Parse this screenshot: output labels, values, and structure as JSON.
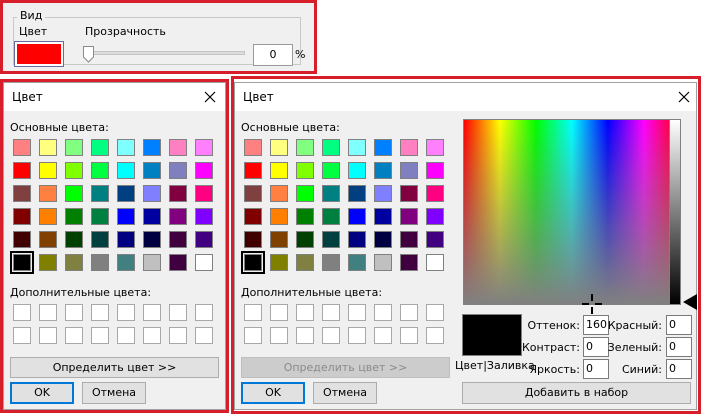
{
  "view_panel": {
    "legend": "Вид",
    "color_label": "Цвет",
    "color_value": "#ff0000",
    "opacity_label": "Прозрачность",
    "opacity_value": "0",
    "percent": "%"
  },
  "dialog_small": {
    "title": "Цвет",
    "basic_label": "Основные цвета:",
    "custom_label": "Дополнительные цвета:",
    "define_button": "Определить цвет >>",
    "ok_button": "OK",
    "cancel_button": "Отмена"
  },
  "dialog_large": {
    "title": "Цвет",
    "basic_label": "Основные цвета:",
    "custom_label": "Дополнительные цвета:",
    "define_button": "Определить цвет >>",
    "ok_button": "OK",
    "cancel_button": "Отмена",
    "preview_label": "Цвет|Заливка",
    "hue_label": "Оттенок:",
    "hue_value": "160",
    "sat_label": "Контраст:",
    "sat_value": "0",
    "lum_label": "Яркость:",
    "lum_value": "0",
    "red_label": "Красный:",
    "red_value": "0",
    "green_label": "Зеленый:",
    "green_value": "0",
    "blue_label": "Синий:",
    "blue_value": "0",
    "add_button": "Добавить в набор"
  },
  "basic_colors": [
    "#ff8080",
    "#ffff80",
    "#80ff80",
    "#00ff80",
    "#80ffff",
    "#0080ff",
    "#ff80c0",
    "#ff80ff",
    "#ff0000",
    "#ffff00",
    "#80ff00",
    "#00ff40",
    "#00ffff",
    "#0080c0",
    "#8080c0",
    "#ff00ff",
    "#804040",
    "#ff8040",
    "#00ff00",
    "#008080",
    "#004080",
    "#8080ff",
    "#800040",
    "#ff0080",
    "#800000",
    "#ff8000",
    "#008000",
    "#008040",
    "#0000ff",
    "#0000a0",
    "#800080",
    "#8000ff",
    "#400000",
    "#804000",
    "#004000",
    "#004040",
    "#000080",
    "#000040",
    "#400040",
    "#400080",
    "#000000",
    "#808000",
    "#808040",
    "#808080",
    "#408080",
    "#c0c0c0",
    "#400040",
    "#ffffff"
  ]
}
